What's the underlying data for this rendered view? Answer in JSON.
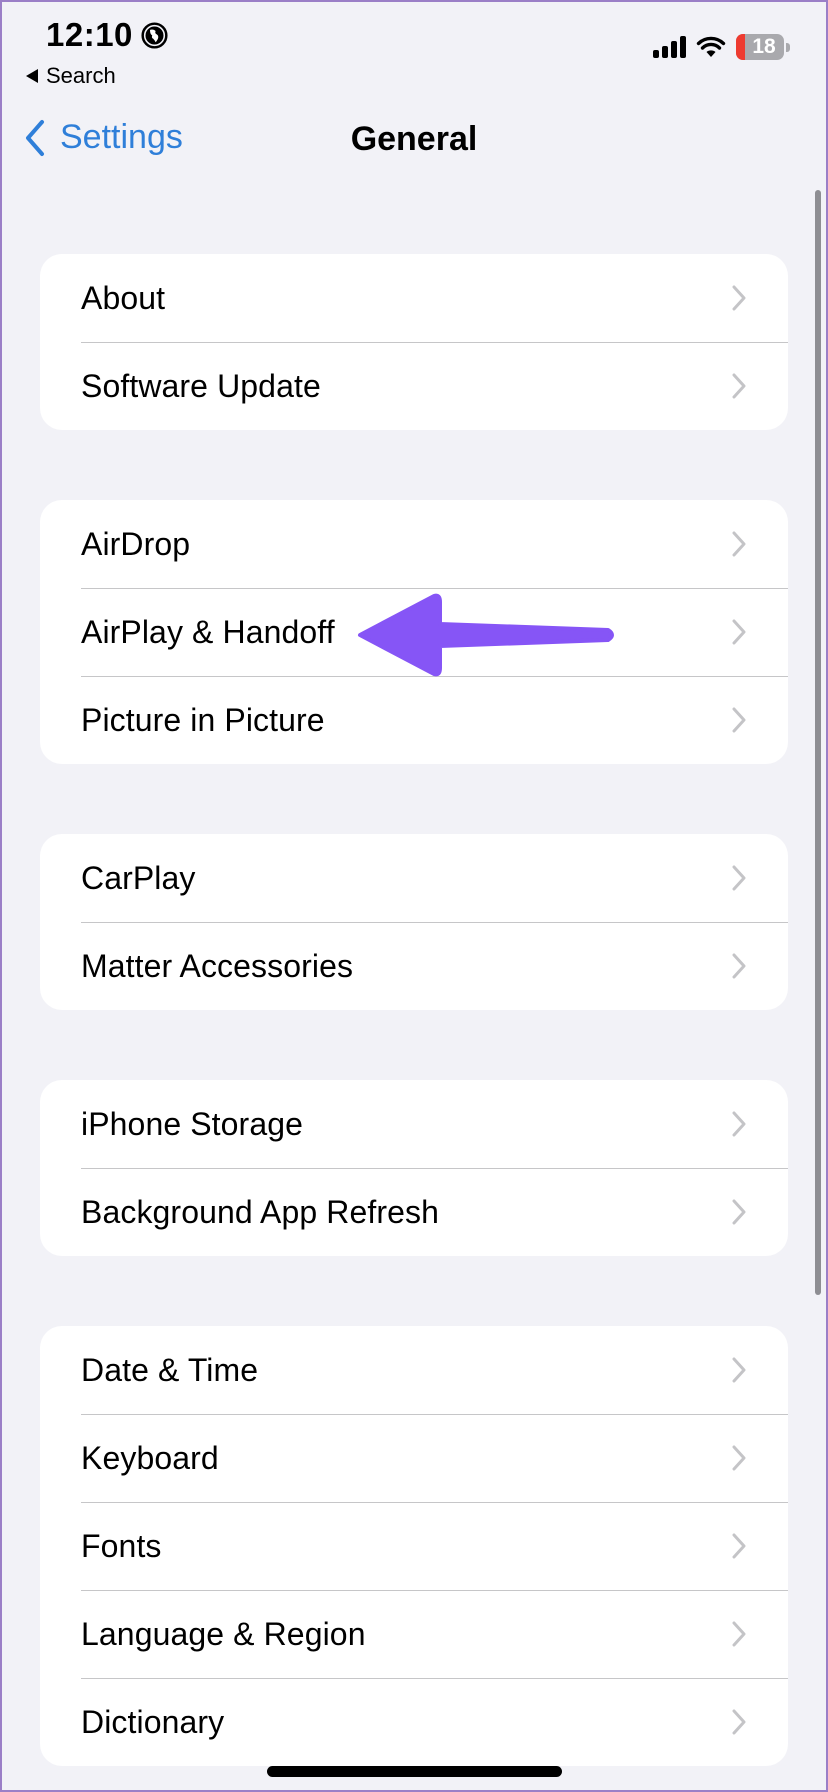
{
  "status_bar": {
    "time": "12:10",
    "location_icon": "globe-icon",
    "back_to_app": "Search",
    "battery_level_text": "18",
    "battery_fraction": 0.18,
    "battery_color": "#ee3b30"
  },
  "nav": {
    "back_label": "Settings",
    "title": "General",
    "accent_color": "#2f7fd9"
  },
  "groups": [
    {
      "items": [
        {
          "label": "About"
        },
        {
          "label": "Software Update"
        }
      ]
    },
    {
      "items": [
        {
          "label": "AirDrop"
        },
        {
          "label": "AirPlay & Handoff"
        },
        {
          "label": "Picture in Picture"
        }
      ]
    },
    {
      "items": [
        {
          "label": "CarPlay"
        },
        {
          "label": "Matter Accessories"
        }
      ]
    },
    {
      "items": [
        {
          "label": "iPhone Storage"
        },
        {
          "label": "Background App Refresh"
        }
      ]
    },
    {
      "items": [
        {
          "label": "Date & Time"
        },
        {
          "label": "Keyboard"
        },
        {
          "label": "Fonts"
        },
        {
          "label": "Language & Region"
        },
        {
          "label": "Dictionary"
        }
      ]
    }
  ],
  "annotation": {
    "type": "arrow",
    "points_to": "AirPlay & Handoff",
    "color": "#8655f6"
  }
}
